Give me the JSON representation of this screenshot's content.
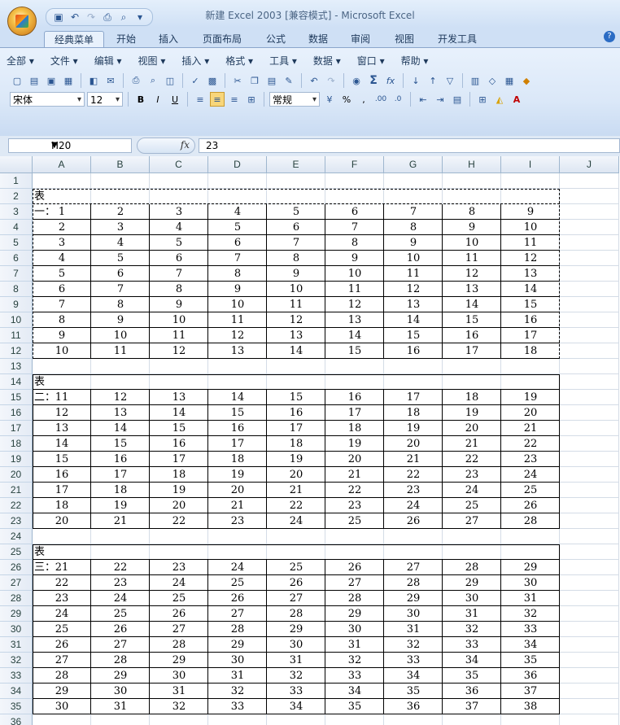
{
  "window": {
    "title": "新建 Excel 2003  [兼容模式] - Microsoft Excel"
  },
  "ribbon_tabs": [
    "经典菜单",
    "开始",
    "插入",
    "页面布局",
    "公式",
    "数据",
    "审阅",
    "视图",
    "开发工具"
  ],
  "classic_menu": [
    "全部 ▾",
    "文件 ▾",
    "编辑 ▾",
    "视图 ▾",
    "插入 ▾",
    "格式 ▾",
    "工具 ▾",
    "数据 ▾",
    "窗口 ▾",
    "帮助 ▾"
  ],
  "toolbar": {
    "font_name": "宋体",
    "font_size": "12",
    "number_format": "常规"
  },
  "formula_bar": {
    "name_box": "H20",
    "fx": "fx",
    "value": "23"
  },
  "columns": [
    "A",
    "B",
    "C",
    "D",
    "E",
    "F",
    "G",
    "H",
    "I",
    "J"
  ],
  "rows": [
    "1",
    "2",
    "3",
    "4",
    "5",
    "6",
    "7",
    "8",
    "9",
    "10",
    "11",
    "12",
    "13",
    "14",
    "15",
    "16",
    "17",
    "18",
    "19",
    "20",
    "21",
    "22",
    "23",
    "24",
    "25",
    "26",
    "27",
    "28",
    "29",
    "30",
    "31",
    "32",
    "33",
    "34",
    "35",
    "36"
  ],
  "tables": [
    {
      "label": "表一：",
      "rows": [
        [
          "1",
          "2",
          "3",
          "4",
          "5",
          "6",
          "7",
          "8",
          "9"
        ],
        [
          "2",
          "3",
          "4",
          "5",
          "6",
          "7",
          "8",
          "9",
          "10"
        ],
        [
          "3",
          "4",
          "5",
          "6",
          "7",
          "8",
          "9",
          "10",
          "11"
        ],
        [
          "4",
          "5",
          "6",
          "7",
          "8",
          "9",
          "10",
          "11",
          "12"
        ],
        [
          "5",
          "6",
          "7",
          "8",
          "9",
          "10",
          "11",
          "12",
          "13"
        ],
        [
          "6",
          "7",
          "8",
          "9",
          "10",
          "11",
          "12",
          "13",
          "14"
        ],
        [
          "7",
          "8",
          "9",
          "10",
          "11",
          "12",
          "13",
          "14",
          "15"
        ],
        [
          "8",
          "9",
          "10",
          "11",
          "12",
          "13",
          "14",
          "15",
          "16"
        ],
        [
          "9",
          "10",
          "11",
          "12",
          "13",
          "14",
          "15",
          "16",
          "17"
        ],
        [
          "10",
          "11",
          "12",
          "13",
          "14",
          "15",
          "16",
          "17",
          "18"
        ]
      ]
    },
    {
      "label": "表二：",
      "rows": [
        [
          "11",
          "12",
          "13",
          "14",
          "15",
          "16",
          "17",
          "18",
          "19"
        ],
        [
          "12",
          "13",
          "14",
          "15",
          "16",
          "17",
          "18",
          "19",
          "20"
        ],
        [
          "13",
          "14",
          "15",
          "16",
          "17",
          "18",
          "19",
          "20",
          "21"
        ],
        [
          "14",
          "15",
          "16",
          "17",
          "18",
          "19",
          "20",
          "21",
          "22"
        ],
        [
          "15",
          "16",
          "17",
          "18",
          "19",
          "20",
          "21",
          "22",
          "23"
        ],
        [
          "16",
          "17",
          "18",
          "19",
          "20",
          "21",
          "22",
          "23",
          "24"
        ],
        [
          "17",
          "18",
          "19",
          "20",
          "21",
          "22",
          "23",
          "24",
          "25"
        ],
        [
          "18",
          "19",
          "20",
          "21",
          "22",
          "23",
          "24",
          "25",
          "26"
        ],
        [
          "20",
          "21",
          "22",
          "23",
          "24",
          "25",
          "26",
          "27",
          "28"
        ]
      ]
    },
    {
      "label": "表三：",
      "rows": [
        [
          "21",
          "22",
          "23",
          "24",
          "25",
          "26",
          "27",
          "28",
          "29"
        ],
        [
          "22",
          "23",
          "24",
          "25",
          "26",
          "27",
          "28",
          "29",
          "30"
        ],
        [
          "23",
          "24",
          "25",
          "26",
          "27",
          "28",
          "29",
          "30",
          "31"
        ],
        [
          "24",
          "25",
          "26",
          "27",
          "28",
          "29",
          "30",
          "31",
          "32"
        ],
        [
          "25",
          "26",
          "27",
          "28",
          "29",
          "30",
          "31",
          "32",
          "33"
        ],
        [
          "26",
          "27",
          "28",
          "29",
          "30",
          "31",
          "32",
          "33",
          "34"
        ],
        [
          "27",
          "28",
          "29",
          "30",
          "31",
          "32",
          "33",
          "34",
          "35"
        ],
        [
          "28",
          "29",
          "30",
          "31",
          "32",
          "33",
          "34",
          "35",
          "36"
        ],
        [
          "29",
          "30",
          "31",
          "32",
          "33",
          "34",
          "35",
          "36",
          "37"
        ],
        [
          "30",
          "31",
          "32",
          "33",
          "34",
          "35",
          "36",
          "37",
          "38"
        ]
      ]
    }
  ]
}
